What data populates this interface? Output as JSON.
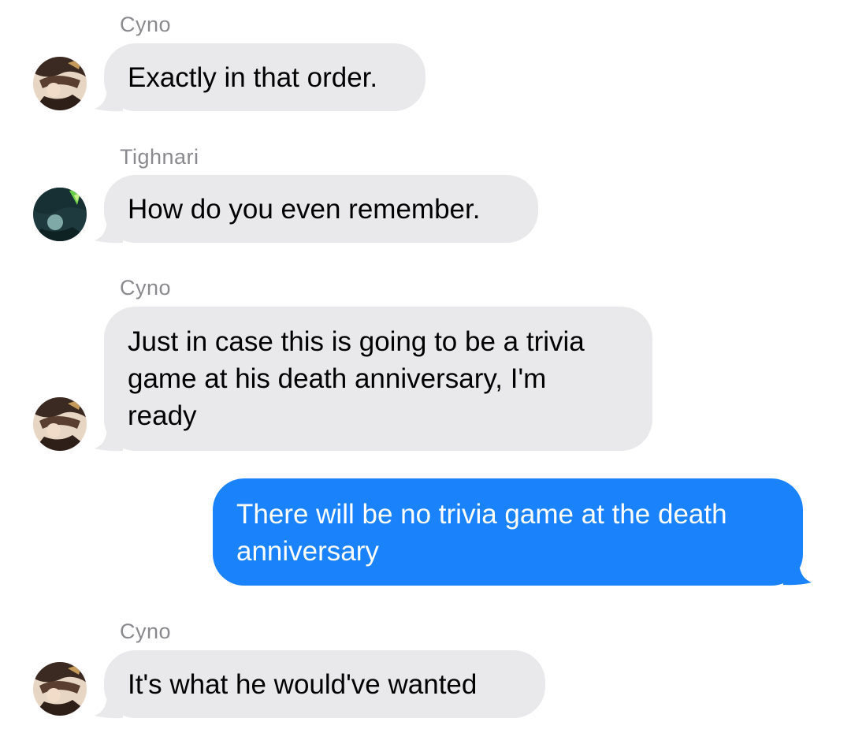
{
  "colors": {
    "incoming_bubble": "#e9e9eb",
    "outgoing_bubble": "#1a82fb",
    "sender_name": "#8a8a8e"
  },
  "messages": [
    {
      "sender": "Cyno",
      "avatar": "cyno-avatar-icon",
      "direction": "incoming",
      "text": "Exactly in that order."
    },
    {
      "sender": "Tighnari",
      "avatar": "tighnari-avatar-icon",
      "direction": "incoming",
      "text": "How do you even remember."
    },
    {
      "sender": "Cyno",
      "avatar": "cyno-avatar-icon",
      "direction": "incoming",
      "text": "Just in case this is going to be a trivia game at his death anniversary, I'm ready"
    },
    {
      "sender": "",
      "direction": "outgoing",
      "text": "There will be no trivia game at the death anniversary"
    },
    {
      "sender": "Cyno",
      "avatar": "cyno-avatar-icon",
      "direction": "incoming",
      "text": "It's what he would've wanted"
    }
  ]
}
